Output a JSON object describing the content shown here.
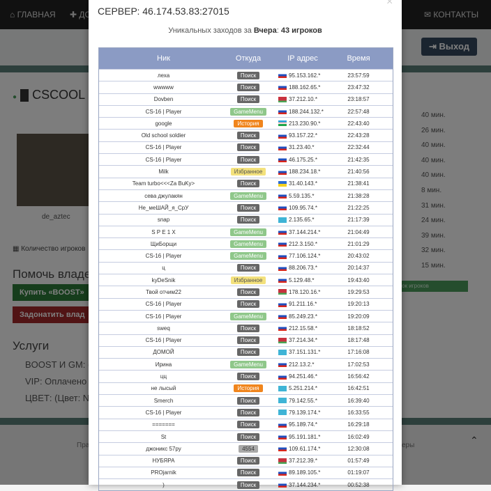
{
  "bg": {
    "nav_home": "ГЛАВНАЯ",
    "nav_partial": "ДО",
    "nav_contacts": "КОНТАКТЫ",
    "logout": "Выход",
    "server_title": "CSCOOL",
    "map": "de_aztec",
    "players_count": "Количество игроков",
    "help": "Помочь владе",
    "buy_boost": "Купить «BOOST»",
    "donate": "Задонатить влад",
    "services": "Услуги",
    "svc1": "BOOST И GM:  (",
    "svc2": "VIP:  Оплачено ,",
    "svc3": "ЦВЕТ:  (Цвет: N",
    "times": [
      "40 мин.",
      "26 мин.",
      "40 мин.",
      "40 мин.",
      "40 мин.",
      "8 мин.",
      "31 мин.",
      "24 мин.",
      "39 мин.",
      "32 мин.",
      "15 мин."
    ],
    "green_bar": "сок игроков",
    "footer_left": "Пра",
    "footer_right": "еры"
  },
  "modal": {
    "close": "×",
    "server": "СЕРВЕР: 46.174.53.83:27015",
    "visits_prefix": "Уникальных заходов за",
    "visits_day": "Вчера",
    "visits_sep": ":",
    "visits_count": "43 игроков",
    "headers": {
      "nick": "Ник",
      "source": "Откуда",
      "ip": "IP адрес",
      "time": "Время"
    }
  },
  "rows": [
    {
      "nick": "леха",
      "source": "Поиск",
      "type": "search",
      "flag": "ru",
      "ip": "95.153.162.*",
      "time": "23:57:59"
    },
    {
      "nick": "wwwww",
      "source": "Поиск",
      "type": "search",
      "flag": "ru",
      "ip": "188.162.65.*",
      "time": "23:47:32"
    },
    {
      "nick": "Dovben",
      "source": "Поиск",
      "type": "search",
      "flag": "by",
      "ip": "37.212.10.*",
      "time": "23:18:57"
    },
    {
      "nick": "CS-16 | Player",
      "source": "GameMenu",
      "type": "gm",
      "flag": "ru",
      "ip": "188.244.132.*",
      "time": "22:57:48"
    },
    {
      "nick": "google",
      "source": "История",
      "type": "hist",
      "flag": "uz",
      "ip": "213.230.90.*",
      "time": "22:43:40"
    },
    {
      "nick": "Old school soldier",
      "source": "Поиск",
      "type": "search",
      "flag": "ru",
      "ip": "93.157.22.*",
      "time": "22:43:28"
    },
    {
      "nick": "CS-16 | Player",
      "source": "Поиск",
      "type": "search",
      "flag": "ru",
      "ip": "31.23.40.*",
      "time": "22:32:44"
    },
    {
      "nick": "CS-16 | Player",
      "source": "Поиск",
      "type": "search",
      "flag": "ru",
      "ip": "46.175.25.*",
      "time": "21:42:35"
    },
    {
      "nick": "Milk",
      "source": "Избранное",
      "type": "fav",
      "flag": "ru",
      "ip": "188.234.18.*",
      "time": "21:40:56"
    },
    {
      "nick": "Team turbo<<<Za BuKy>",
      "source": "Поиск",
      "type": "search",
      "flag": "ua",
      "ip": "31.40.143.*",
      "time": "21:38:41"
    },
    {
      "nick": "сева джулакян",
      "source": "GameMenu",
      "type": "gm",
      "flag": "ru",
      "ip": "5.59.135.*",
      "time": "21:38:28"
    },
    {
      "nick": "Не_меШАЙ_я_СрУ",
      "source": "Поиск",
      "type": "search",
      "flag": "ru",
      "ip": "109.95.74.*",
      "time": "21:22:25"
    },
    {
      "nick": "snap",
      "source": "Поиск",
      "type": "search",
      "flag": "kz",
      "ip": "2.135.65.*",
      "time": "21:17:39"
    },
    {
      "nick": "S P E 1 X",
      "source": "GameMenu",
      "type": "gm",
      "flag": "ru",
      "ip": "37.144.214.*",
      "time": "21:04:49"
    },
    {
      "nick": "ЩиБорщи",
      "source": "GameMenu",
      "type": "gm",
      "flag": "ru",
      "ip": "212.3.150.*",
      "time": "21:01:29"
    },
    {
      "nick": "CS-16 | Player",
      "source": "GameMenu",
      "type": "gm",
      "flag": "ru",
      "ip": "77.106.124.*",
      "time": "20:43:02"
    },
    {
      "nick": "ц",
      "source": "Поиск",
      "type": "search",
      "flag": "ru",
      "ip": "88.206.73.*",
      "time": "20:14:37"
    },
    {
      "nick": "kyDeSnik",
      "source": "Избранное",
      "type": "fav",
      "flag": "ru",
      "ip": "5.129.48.*",
      "time": "19:43:40"
    },
    {
      "nick": "Твой отчим22",
      "source": "Поиск",
      "type": "search",
      "flag": "by",
      "ip": "178.120.16.*",
      "time": "19:29:53"
    },
    {
      "nick": "CS-16 | Player",
      "source": "Поиск",
      "type": "search",
      "flag": "ru",
      "ip": "91.211.16.*",
      "time": "19:20:13"
    },
    {
      "nick": "CS-16 | Player",
      "source": "GameMenu",
      "type": "gm",
      "flag": "ru",
      "ip": "85.249.23.*",
      "time": "19:20:09"
    },
    {
      "nick": "sweq",
      "source": "Поиск",
      "type": "search",
      "flag": "ru",
      "ip": "212.15.58.*",
      "time": "18:18:52"
    },
    {
      "nick": "CS-16 | Player",
      "source": "Поиск",
      "type": "search",
      "flag": "by",
      "ip": "37.214.34.*",
      "time": "18:17:48"
    },
    {
      "nick": "ДОМОЙ",
      "source": "Поиск",
      "type": "search",
      "flag": "kz",
      "ip": "37.151.131.*",
      "time": "17:16:08"
    },
    {
      "nick": "Ирина",
      "source": "GameMenu",
      "type": "gm",
      "flag": "ru",
      "ip": "212.13.2.*",
      "time": "17:02:53"
    },
    {
      "nick": "цц",
      "source": "Поиск",
      "type": "search",
      "flag": "ru",
      "ip": "94.251.46.*",
      "time": "16:56:42"
    },
    {
      "nick": "не лысый",
      "source": "История",
      "type": "hist",
      "flag": "kz",
      "ip": "5.251.214.*",
      "time": "16:42:51"
    },
    {
      "nick": "Smerch",
      "source": "Поиск",
      "type": "search",
      "flag": "kz",
      "ip": "79.142.55.*",
      "time": "16:39:40"
    },
    {
      "nick": "CS-16 | Player",
      "source": "Поиск",
      "type": "search",
      "flag": "kz",
      "ip": "79.139.174.*",
      "time": "16:33:55"
    },
    {
      "nick": "=======",
      "source": "Поиск",
      "type": "search",
      "flag": "ru",
      "ip": "95.189.74.*",
      "time": "16:29:18"
    },
    {
      "nick": "St",
      "source": "Поиск",
      "type": "search",
      "flag": "ru",
      "ip": "95.191.181.*",
      "time": "16:02:49"
    },
    {
      "nick": "джоникс 57ру",
      "source": "4554",
      "type": "num",
      "flag": "ru",
      "ip": "109.61.174.*",
      "time": "12:30:08"
    },
    {
      "nick": "НУБЯРА",
      "source": "Поиск",
      "type": "search",
      "flag": "by",
      "ip": "37.212.39.*",
      "time": "01:57:49"
    },
    {
      "nick": "PROjarnik",
      "source": "Поиск",
      "type": "search",
      "flag": "ru",
      "ip": "89.189.105.*",
      "time": "01:19:07"
    },
    {
      "nick": ")",
      "source": "Поиск",
      "type": "search",
      "flag": "ru",
      "ip": "37.144.234.*",
      "time": "00:52:38"
    }
  ]
}
